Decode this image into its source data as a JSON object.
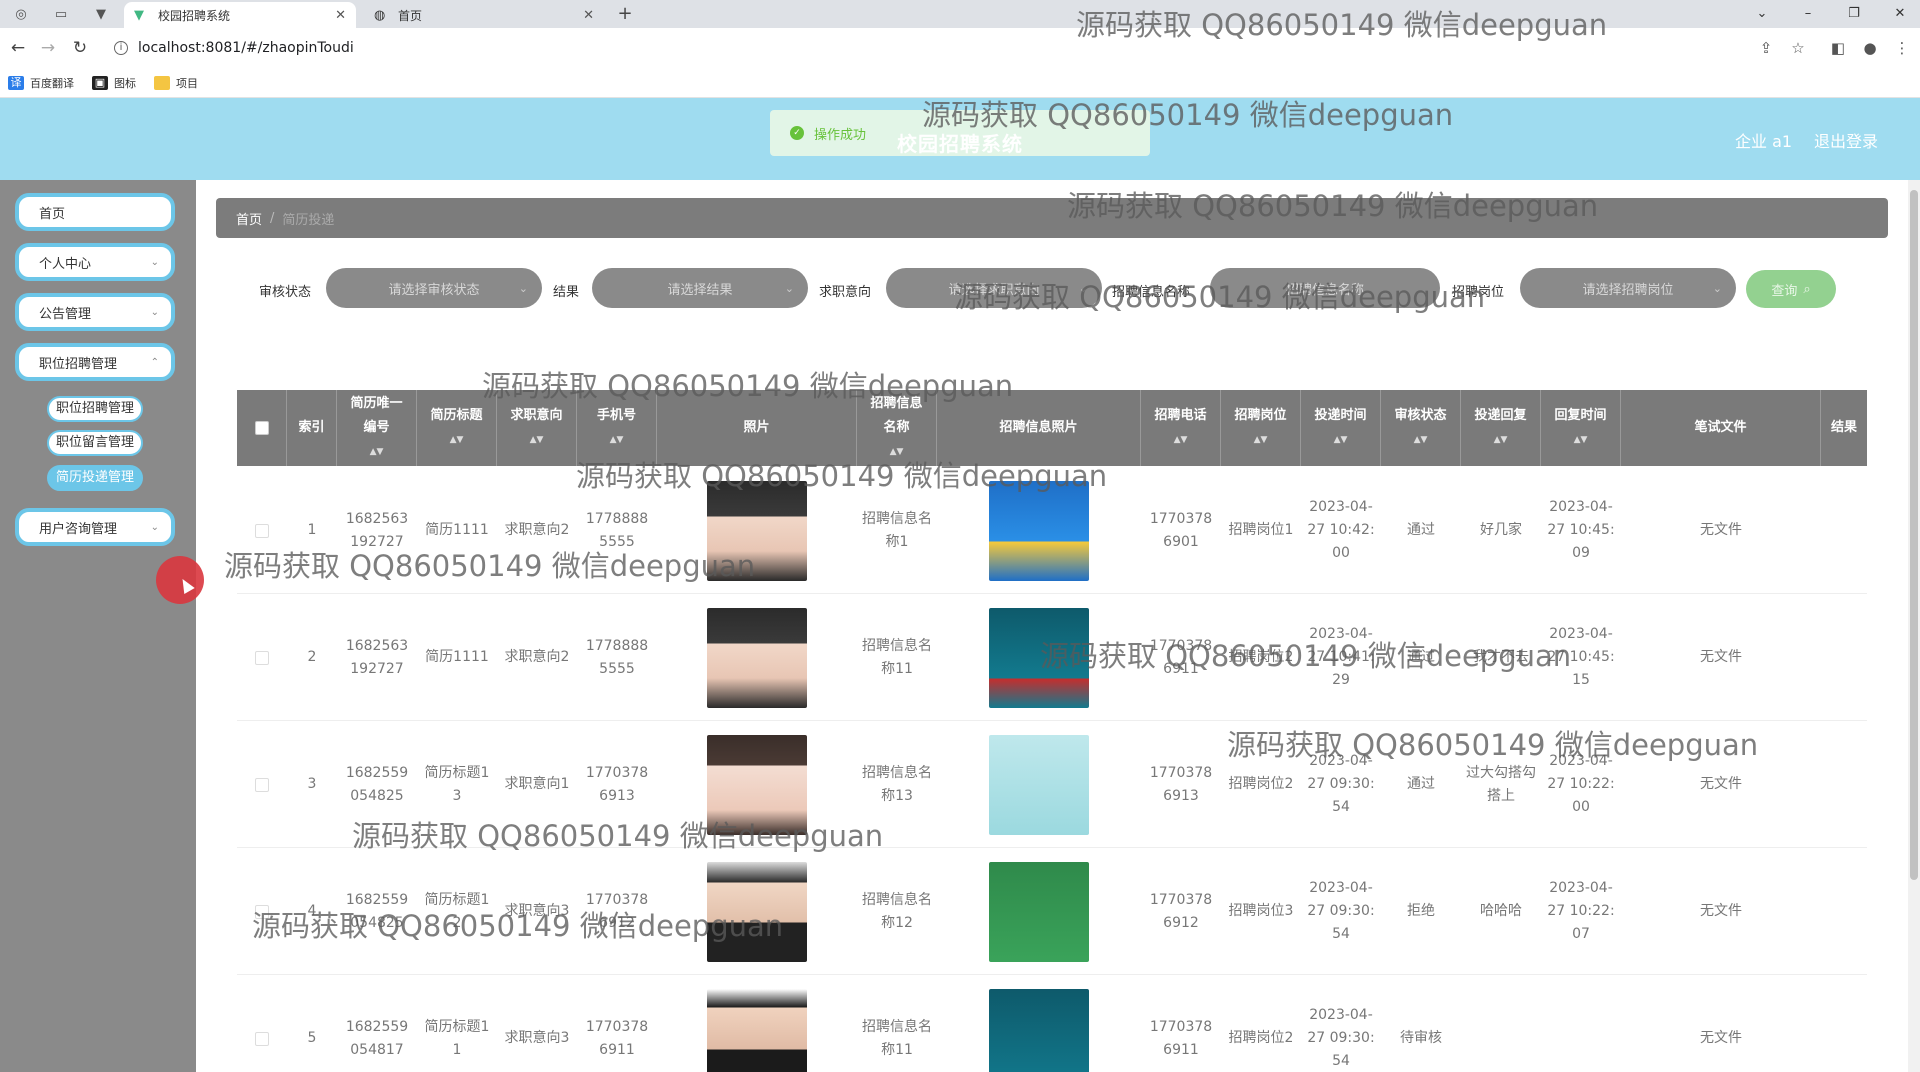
{
  "browser": {
    "tabs": [
      {
        "title": "校园招聘系统",
        "icon": "vue-icon"
      },
      {
        "title": "首页",
        "icon": "globe-icon"
      }
    ],
    "url": "localhost:8081/#/zhaopinToudi",
    "bookmarks": [
      {
        "label": "百度翻译",
        "icon": "translate-icon"
      },
      {
        "label": "图标",
        "icon": "image-icon"
      },
      {
        "label": "项目",
        "icon": "folder-icon"
      }
    ]
  },
  "header": {
    "title": "校园招聘系统",
    "toast": "操作成功",
    "user": "企业 a1",
    "logout": "退出登录"
  },
  "sidebar": {
    "items": [
      {
        "label": "首页"
      },
      {
        "label": "个人中心"
      },
      {
        "label": "公告管理"
      },
      {
        "label": "职位招聘管理"
      },
      {
        "label": "用户咨询管理"
      }
    ],
    "subitems": [
      {
        "label": "职位招聘管理"
      },
      {
        "label": "职位留言管理"
      },
      {
        "label": "简历投递管理"
      }
    ]
  },
  "breadcrumb": {
    "home": "首页",
    "current": "简历投递"
  },
  "filters": [
    {
      "label": "审核状态",
      "placeholder": "请选择审核状态"
    },
    {
      "label": "结果",
      "placeholder": "请选择结果"
    },
    {
      "label": "求职意向",
      "placeholder": "请选择求职意向"
    },
    {
      "label": "招聘信息名称",
      "placeholder": "招聘信息名称"
    },
    {
      "label": "招聘岗位",
      "placeholder": "请选择招聘岗位"
    }
  ],
  "search_label": "查询",
  "table": {
    "columns": [
      "索引",
      "简历唯一编号",
      "简历标题",
      "求职意向",
      "手机号",
      "照片",
      "招聘信息名称",
      "招聘信息照片",
      "招聘电话",
      "招聘岗位",
      "投递时间",
      "审核状态",
      "投递回复",
      "回复时间",
      "笔试文件",
      "结果"
    ],
    "rows": [
      {
        "idx": "1",
        "id": "1682563192727",
        "title": "简历1111",
        "intent": "求职意向2",
        "phone": "17788885555",
        "job": "招聘信息名称1",
        "tel": "17703786901",
        "pos": "招聘岗位1",
        "time": "2023-04-27 10:42:00",
        "status": "通过",
        "reply": "好几家",
        "rtime": "2023-04-27 10:45:09",
        "file": "无文件"
      },
      {
        "idx": "2",
        "id": "1682563192727",
        "title": "简历1111",
        "intent": "求职意向2",
        "phone": "17788885555",
        "job": "招聘信息名称11",
        "tel": "17703786911",
        "pos": "招聘岗位2",
        "time": "2023-04-27 10:41:29",
        "status": "通过",
        "reply": "我才不去",
        "rtime": "2023-04-27 10:45:15",
        "file": "无文件"
      },
      {
        "idx": "3",
        "id": "1682559054825",
        "title": "简历标题13",
        "intent": "求职意向1",
        "phone": "17703786913",
        "job": "招聘信息名称13",
        "tel": "17703786913",
        "pos": "招聘岗位2",
        "time": "2023-04-27 09:30:54",
        "status": "通过",
        "reply": "过大勾搭勾搭上",
        "rtime": "2023-04-27 10:22:00",
        "file": "无文件"
      },
      {
        "idx": "4",
        "id": "1682559054825",
        "title": "简历标题12",
        "intent": "求职意向3",
        "phone": "17703786912",
        "job": "招聘信息名称12",
        "tel": "17703786912",
        "pos": "招聘岗位3",
        "time": "2023-04-27 09:30:54",
        "status": "拒绝",
        "reply": "哈哈哈",
        "rtime": "2023-04-27 10:22:07",
        "file": "无文件"
      },
      {
        "idx": "5",
        "id": "1682559054817",
        "title": "简历标题11",
        "intent": "求职意向3",
        "phone": "17703786911",
        "job": "招聘信息名称11",
        "tel": "17703786911",
        "pos": "招聘岗位2",
        "time": "2023-04-27 09:30:54",
        "status": "待审核",
        "reply": "",
        "rtime": "",
        "file": "无文件"
      }
    ]
  },
  "watermark": "源码获取 QQ86050149 微信deepguan",
  "colors": {
    "header": "#9fdcf0",
    "sidebar": "#8a8a8a",
    "accent": "#6cc6e8",
    "table_head": "#7a7a7a",
    "search": "#93d190",
    "success": "#67c23a"
  }
}
